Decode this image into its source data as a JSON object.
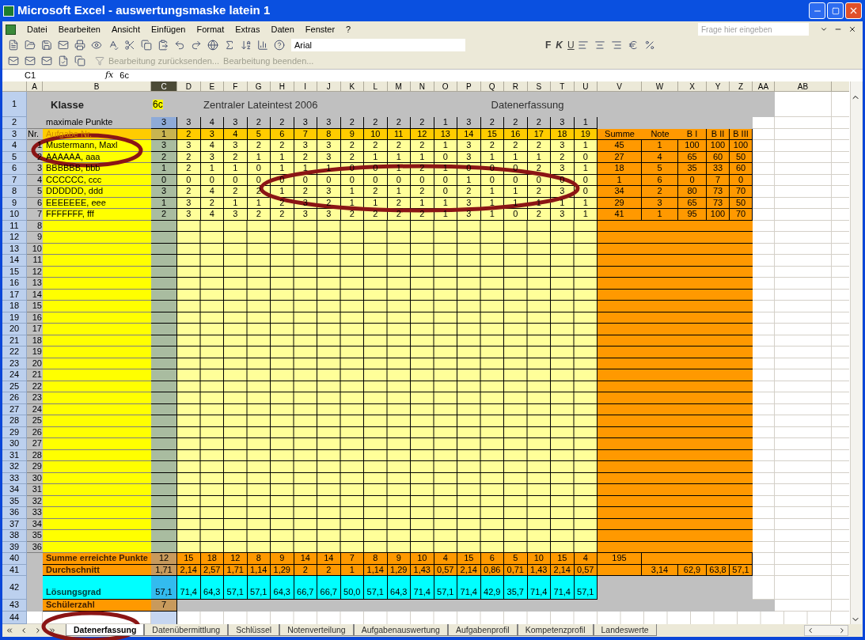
{
  "window": {
    "title": "Microsoft Excel - auswertungsmaske latein 1"
  },
  "menu": [
    "Datei",
    "Bearbeiten",
    "Ansicht",
    "Einfügen",
    "Format",
    "Extras",
    "Daten",
    "Fenster",
    "?"
  ],
  "help_box": {
    "placeholder": "Frage hier eingeben"
  },
  "font_box": {
    "value": "Arial"
  },
  "format_buttons": [
    "F",
    "K",
    "U"
  ],
  "review_toolbar": [
    "Bearbeitung zurücksenden...",
    "Bearbeitung beenden..."
  ],
  "formula_bar": {
    "name_box": "C1",
    "function_label": "fx",
    "formula": "6c"
  },
  "columns": [
    {
      "label": "A",
      "selected": false
    },
    {
      "label": "B",
      "selected": false
    },
    {
      "label": "C",
      "selected": true
    },
    {
      "label": "D",
      "selected": false
    },
    {
      "label": "E",
      "selected": false
    },
    {
      "label": "F",
      "selected": false
    },
    {
      "label": "G",
      "selected": false
    },
    {
      "label": "H",
      "selected": false
    },
    {
      "label": "I",
      "selected": false
    },
    {
      "label": "J",
      "selected": false
    },
    {
      "label": "K",
      "selected": false
    },
    {
      "label": "L",
      "selected": false
    },
    {
      "label": "M",
      "selected": false
    },
    {
      "label": "N",
      "selected": false
    },
    {
      "label": "O",
      "selected": false
    },
    {
      "label": "P",
      "selected": false
    },
    {
      "label": "Q",
      "selected": false
    },
    {
      "label": "R",
      "selected": false
    },
    {
      "label": "S",
      "selected": false
    },
    {
      "label": "T",
      "selected": false
    },
    {
      "label": "U",
      "selected": false
    },
    {
      "label": "V",
      "selected": false
    },
    {
      "label": "W",
      "selected": false
    },
    {
      "label": "X",
      "selected": false
    },
    {
      "label": "Y",
      "selected": false
    },
    {
      "label": "Z",
      "selected": false
    },
    {
      "label": "AA",
      "selected": false
    },
    {
      "label": "AB",
      "selected": false
    }
  ],
  "title_row": {
    "row": "1",
    "class_label": "Klasse",
    "class_value": "6c",
    "test_title": "Zentraler Lateintest 2006",
    "section": "Datenerfassung"
  },
  "max_row": {
    "row": "2",
    "label": "maximale Punkte",
    "values": [
      "3",
      "3",
      "4",
      "3",
      "2",
      "2",
      "3",
      "3",
      "2",
      "2",
      "2",
      "2",
      "1",
      "3",
      "2",
      "2",
      "2",
      "3",
      "1"
    ]
  },
  "task_row": {
    "row": "3",
    "nr_label": "Nr.",
    "label": "Aufgabe Nr.",
    "tasks": [
      "1",
      "2",
      "3",
      "4",
      "5",
      "6",
      "7",
      "8",
      "9",
      "10",
      "11",
      "12",
      "13",
      "14",
      "15",
      "16",
      "17",
      "18",
      "19"
    ],
    "summary_headers": [
      "Summe",
      "Note",
      "B I",
      "B II",
      "B III"
    ]
  },
  "students": [
    {
      "row": "4",
      "nr": "1",
      "name": "Mustermann, Maxl",
      "points": [
        "3",
        "3",
        "4",
        "3",
        "2",
        "2",
        "3",
        "3",
        "2",
        "2",
        "2",
        "2",
        "1",
        "3",
        "2",
        "2",
        "2",
        "3",
        "1"
      ],
      "sum": "45",
      "grade": "1",
      "b": [
        "100",
        "100",
        "100"
      ]
    },
    {
      "row": "5",
      "nr": "2",
      "name": "AAAAAA, aaa",
      "points": [
        "2",
        "2",
        "3",
        "2",
        "1",
        "1",
        "2",
        "3",
        "2",
        "1",
        "1",
        "1",
        "0",
        "3",
        "1",
        "1",
        "1",
        "2",
        "0"
      ],
      "sum": "27",
      "grade": "4",
      "b": [
        "65",
        "60",
        "50"
      ]
    },
    {
      "row": "6",
      "nr": "3",
      "name": "BBBBBB, bbb",
      "points": [
        "1",
        "2",
        "1",
        "1",
        "0",
        "1",
        "1",
        "1",
        "0",
        "0",
        "1",
        "2",
        "1",
        "0",
        "0",
        "0",
        "2",
        "3",
        "1"
      ],
      "sum": "18",
      "grade": "5",
      "b": [
        "35",
        "33",
        "60"
      ]
    },
    {
      "row": "7",
      "nr": "4",
      "name": "CCCCCC, ccc",
      "points": [
        "0",
        "0",
        "0",
        "0",
        "0",
        "0",
        "0",
        "0",
        "0",
        "0",
        "0",
        "0",
        "0",
        "1",
        "0",
        "0",
        "0",
        "0",
        "0"
      ],
      "sum": "1",
      "grade": "6",
      "b": [
        "0",
        "7",
        "0"
      ]
    },
    {
      "row": "8",
      "nr": "5",
      "name": "DDDDDD, ddd",
      "points": [
        "3",
        "2",
        "4",
        "2",
        "2",
        "1",
        "2",
        "3",
        "1",
        "2",
        "1",
        "2",
        "0",
        "2",
        "1",
        "1",
        "2",
        "3",
        "0"
      ],
      "sum": "34",
      "grade": "2",
      "b": [
        "80",
        "73",
        "70"
      ]
    },
    {
      "row": "9",
      "nr": "6",
      "name": "EEEEEEE, eee",
      "points": [
        "1",
        "3",
        "2",
        "1",
        "1",
        "2",
        "3",
        "2",
        "1",
        "1",
        "2",
        "1",
        "1",
        "3",
        "1",
        "1",
        "1",
        "1",
        "1"
      ],
      "sum": "29",
      "grade": "3",
      "b": [
        "65",
        "73",
        "50"
      ]
    },
    {
      "row": "10",
      "nr": "7",
      "name": "FFFFFFF, fff",
      "points": [
        "2",
        "3",
        "4",
        "3",
        "2",
        "2",
        "3",
        "3",
        "2",
        "2",
        "2",
        "2",
        "1",
        "3",
        "1",
        "0",
        "2",
        "3",
        "1"
      ],
      "sum": "41",
      "grade": "1",
      "b": [
        "95",
        "100",
        "70"
      ]
    }
  ],
  "empty_rows": [
    {
      "row": "11",
      "nr": "8"
    },
    {
      "row": "12",
      "nr": "9"
    },
    {
      "row": "13",
      "nr": "10"
    },
    {
      "row": "14",
      "nr": "11"
    },
    {
      "row": "15",
      "nr": "12"
    },
    {
      "row": "16",
      "nr": "13"
    },
    {
      "row": "17",
      "nr": "14"
    },
    {
      "row": "18",
      "nr": "15"
    },
    {
      "row": "19",
      "nr": "16"
    },
    {
      "row": "20",
      "nr": "17"
    },
    {
      "row": "21",
      "nr": "18"
    },
    {
      "row": "22",
      "nr": "19"
    },
    {
      "row": "23",
      "nr": "20"
    },
    {
      "row": "24",
      "nr": "21"
    },
    {
      "row": "25",
      "nr": "22"
    },
    {
      "row": "26",
      "nr": "23"
    },
    {
      "row": "27",
      "nr": "24"
    },
    {
      "row": "28",
      "nr": "25"
    },
    {
      "row": "29",
      "nr": "26"
    },
    {
      "row": "30",
      "nr": "27"
    },
    {
      "row": "31",
      "nr": "28"
    },
    {
      "row": "32",
      "nr": "29"
    },
    {
      "row": "33",
      "nr": "30"
    },
    {
      "row": "34",
      "nr": "31"
    },
    {
      "row": "35",
      "nr": "32"
    },
    {
      "row": "36",
      "nr": "33"
    },
    {
      "row": "37",
      "nr": "34"
    },
    {
      "row": "38",
      "nr": "35"
    },
    {
      "row": "39",
      "nr": "36"
    }
  ],
  "totals": {
    "row": "40",
    "label": "Summe erreichte Punkte",
    "values": [
      "12",
      "15",
      "18",
      "12",
      "8",
      "9",
      "14",
      "14",
      "7",
      "8",
      "9",
      "10",
      "4",
      "15",
      "6",
      "5",
      "10",
      "15",
      "4"
    ],
    "sum": "195"
  },
  "average": {
    "row": "41",
    "label": "Durchschnitt",
    "values": [
      "1,71",
      "2,14",
      "2,57",
      "1,71",
      "1,14",
      "1,29",
      "2",
      "2",
      "1",
      "1,14",
      "1,29",
      "1,43",
      "0,57",
      "2,14",
      "0,86",
      "0,71",
      "1,43",
      "2,14",
      "0,57"
    ],
    "grade": "3,14",
    "b": [
      "62,9",
      "63,8",
      "57,1"
    ]
  },
  "solution": {
    "row": "42",
    "label": "Lösungsgrad",
    "values": [
      "57,1",
      "71,4",
      "64,3",
      "57,1",
      "57,1",
      "64,3",
      "66,7",
      "66,7",
      "50,0",
      "57,1",
      "64,3",
      "71,4",
      "57,1",
      "71,4",
      "42,9",
      "35,7",
      "71,4",
      "71,4",
      "57,1"
    ]
  },
  "count": {
    "row": "43",
    "label": "Schülerzahl",
    "value": "7"
  },
  "blank_row": {
    "row": "44"
  },
  "sheet_tabs": [
    {
      "label": "Datenerfassung",
      "selected": true
    },
    {
      "label": "Datenübermittlung",
      "selected": false
    },
    {
      "label": "Schlüssel",
      "selected": false
    },
    {
      "label": "Notenverteilung",
      "selected": false
    },
    {
      "label": "Aufgabenauswertung",
      "selected": false
    },
    {
      "label": "Aufgabenprofil",
      "selected": false
    },
    {
      "label": "Kompetenzprofil",
      "selected": false
    },
    {
      "label": "Landeswerte",
      "selected": false
    }
  ]
}
